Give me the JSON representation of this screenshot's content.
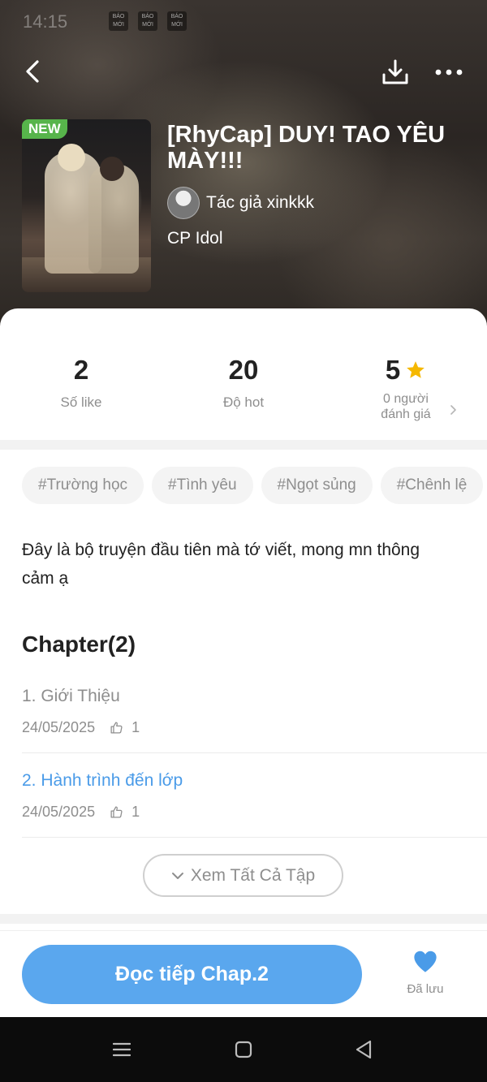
{
  "status_bar": {
    "time": "14:15",
    "badges": [
      "BÁO MỚI",
      "BÁO MỚI",
      "BÁO MỚI"
    ]
  },
  "header": {
    "badge": "NEW",
    "title": "[RhyCap] DUY! TAO YÊU MÀY!!!",
    "author": "Tác giả xinkkk",
    "category": "CP Idol"
  },
  "stats": {
    "likes": {
      "value": "2",
      "label": "Số like"
    },
    "hot": {
      "value": "20",
      "label": "Độ hot"
    },
    "rating": {
      "value": "5",
      "label_line1": "0 người",
      "label_line2": "đánh giá"
    }
  },
  "tags": [
    "#Trường học",
    "#Tình yêu",
    "#Ngọt sủng",
    "#Chênh lệ"
  ],
  "description": "Đây là bộ truyện đầu tiên mà tớ viết, mong mn thông cảm ạ",
  "chapters_heading": "Chapter(2)",
  "chapters": [
    {
      "title": "1. Giới Thiệu",
      "date": "24/05/2025",
      "likes": "1",
      "active": false
    },
    {
      "title": "2. Hành trình đến lớp",
      "date": "24/05/2025",
      "likes": "1",
      "active": true
    }
  ],
  "view_all_label": "Xem Tất Cả Tập",
  "actions": {
    "read_label": "Đọc tiếp Chap.2",
    "saved_label": "Đã lưu"
  },
  "colors": {
    "accent": "#5aa7ee",
    "link_active": "#4a9be8",
    "new_badge": "#57b44b",
    "star": "#f5b800",
    "saved_heart": "#4a9be8"
  },
  "icons": [
    "back-icon",
    "download-icon",
    "more-icon",
    "star-icon",
    "chevron-right-icon",
    "thumb-up-icon",
    "chevron-down-icon",
    "heart-icon",
    "menu-icon",
    "home-square-icon",
    "back-triangle-icon"
  ]
}
